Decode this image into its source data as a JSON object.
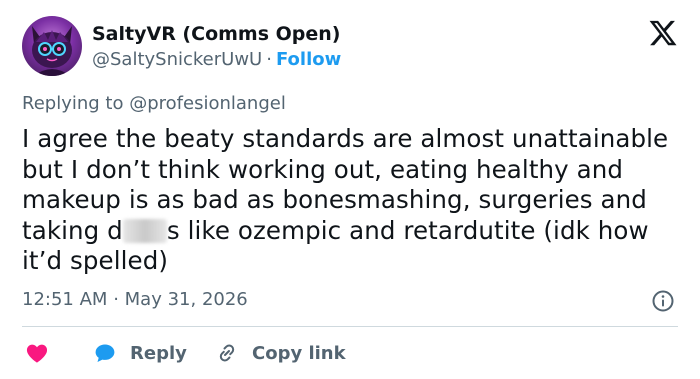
{
  "author": {
    "display_name": "SaltyVR (Comms Open)",
    "handle": "@SaltySnickerUwU",
    "separator": "·",
    "follow_label": "Follow"
  },
  "reply_context": {
    "prefix": "Replying to",
    "handle": "@profesionlangel"
  },
  "tweet": {
    "text_before_censor": "I agree the beaty standards are almost unattainable but I don’t think working out, eating healthy and makeup is as bad as bonesmashing, surgeries and taking d",
    "text_after_censor": "s like ozempic and retardutite (idk how it’d spelled)"
  },
  "meta": {
    "time": "12:51 AM",
    "separator": "·",
    "date": "May 31, 2026"
  },
  "actions": {
    "reply_label": "Reply",
    "copy_link_label": "Copy link"
  },
  "icons": {
    "like": "heart-icon",
    "reply": "reply-bubble-icon",
    "copy": "link-icon",
    "info": "info-icon",
    "brand": "x-logo-icon"
  },
  "colors": {
    "accent": "#1d9bf0",
    "like": "#f91880",
    "text": "#0f1419",
    "muted": "#536471"
  }
}
